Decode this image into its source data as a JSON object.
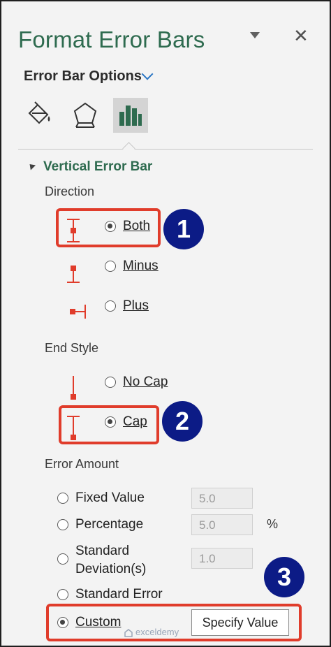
{
  "pane": {
    "title": "Format Error Bars",
    "close_glyph": "✕"
  },
  "options": {
    "label": "Error Bar Options",
    "tabs": [
      "fill-line-icon",
      "effects-pentagon-icon",
      "bar-chart-icon"
    ]
  },
  "section": {
    "title": "Vertical Error Bar"
  },
  "direction": {
    "label": "Direction",
    "options": [
      {
        "label": "Both",
        "selected": true,
        "icon": "error-bar-both-icon"
      },
      {
        "label": "Minus",
        "selected": false,
        "icon": "error-bar-minus-icon"
      },
      {
        "label": "Plus",
        "selected": false,
        "icon": "error-bar-plus-icon"
      }
    ]
  },
  "end_style": {
    "label": "End Style",
    "options": [
      {
        "label": "No Cap",
        "selected": false,
        "icon": "no-cap-icon"
      },
      {
        "label": "Cap",
        "selected": true,
        "icon": "cap-icon"
      }
    ]
  },
  "error_amount": {
    "label": "Error Amount",
    "fixed_value": {
      "label": "Fixed Value",
      "value": "5.0"
    },
    "percentage": {
      "label": "Percentage",
      "value": "5.0",
      "unit": "%"
    },
    "std_dev": {
      "label_line1": "Standard",
      "label_line2": "Deviation(s)",
      "value": "1.0"
    },
    "std_error": {
      "label": "Standard Error"
    },
    "custom": {
      "label": "Custom",
      "selected": true,
      "button": "Specify Value"
    }
  },
  "badges": [
    "1",
    "2",
    "3"
  ],
  "watermark": "exceldemy",
  "colors": {
    "title_green": "#2e6b4f",
    "highlight_red": "#e03c2b",
    "badge_navy": "#0c1b86",
    "error_bar_red": "#e03c2b"
  }
}
